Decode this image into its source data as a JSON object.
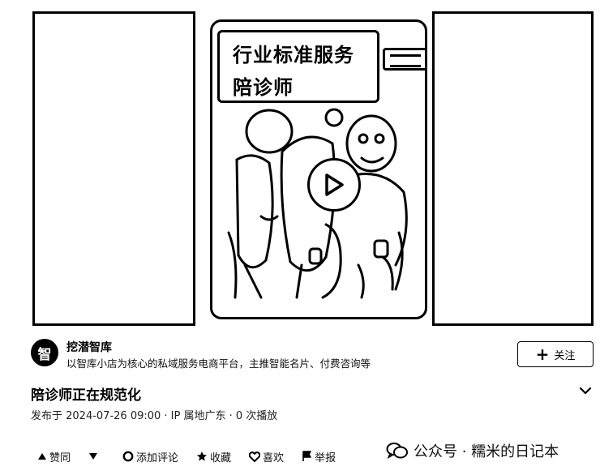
{
  "video": {
    "banner_line1": "行业标准服务",
    "banner_line2": "陪诊师"
  },
  "author": {
    "avatar_text": "智",
    "name": "挖潜智库",
    "description": "以智库小店为核心的私域服务电商平台，主推智能名片、付费咨询等",
    "follow_label": "关注"
  },
  "post": {
    "title": "陪诊师正在规范化",
    "meta": "发布于 2024-07-26 09:00 · IP 属地广东 · 0 次播放"
  },
  "actions": {
    "like": "赞同",
    "comment": "添加评论",
    "collect": "收藏",
    "favorite": "喜欢",
    "report": "举报"
  },
  "watermark": "公众号 · 糯米的日记本"
}
